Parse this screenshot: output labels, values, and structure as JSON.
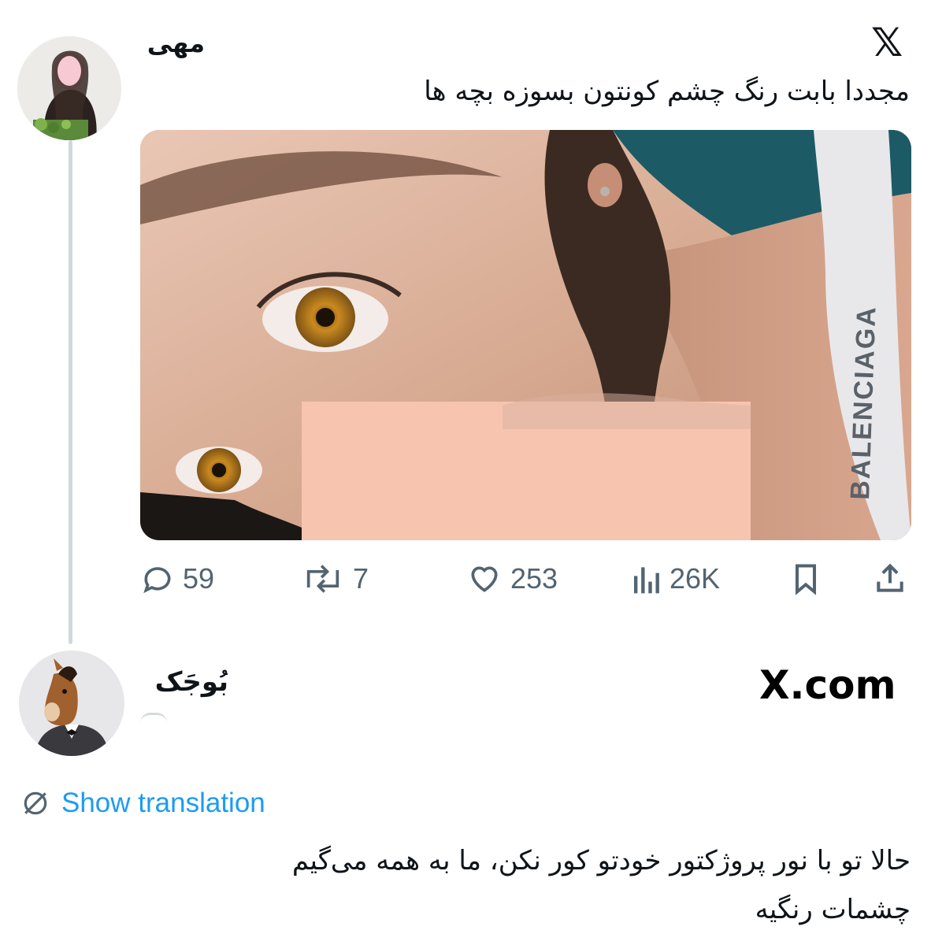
{
  "tweet": {
    "author": "مهی",
    "text": "مجددا بابت رنگ چشم کونتون بسوزه بچه ها",
    "brand_icon": "x-logo-icon",
    "image_text": "BALENCIAGA",
    "actions": {
      "replies": "59",
      "retweets": "7",
      "likes": "253",
      "views": "26K"
    }
  },
  "reply": {
    "author": "بُوجَک",
    "watermark": "X.com",
    "show_translation": "Show translation",
    "text_line1": "حالا تو با نور پروژکتور خودتو کور نکن، ما به همه می‌گیم",
    "text_line2": "چشمات رنگیه"
  },
  "colors": {
    "link": "#1d9bf0",
    "muted": "#536471",
    "thread_line": "#cfd9de"
  }
}
